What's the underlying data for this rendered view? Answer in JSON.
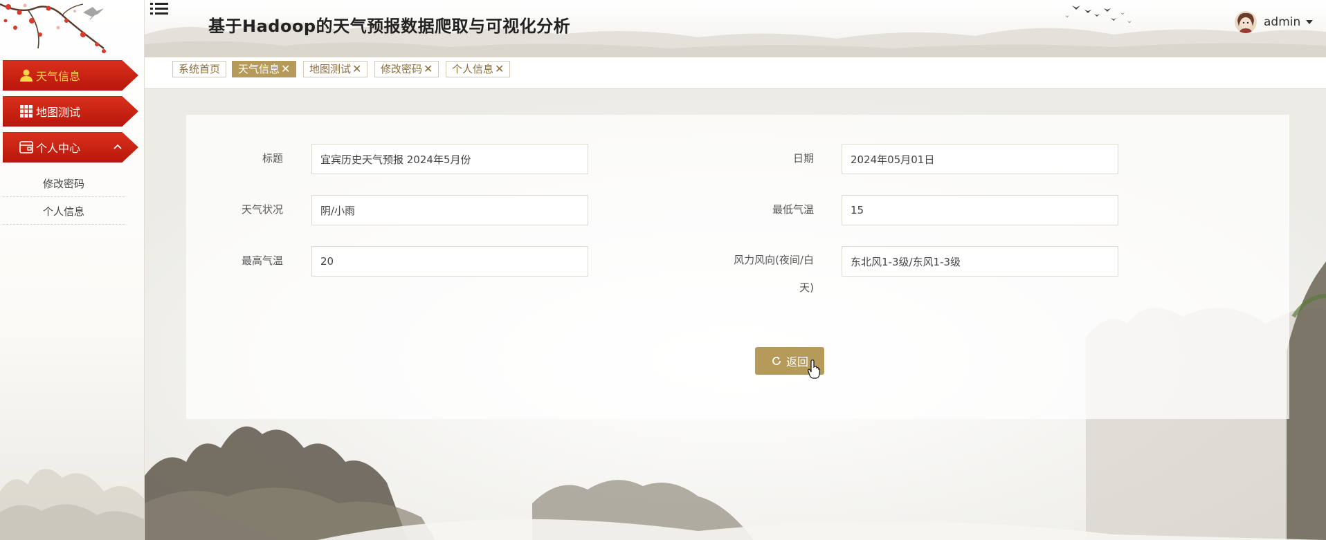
{
  "header": {
    "title": "基于Hadoop的天气预报数据爬取与可视化分析",
    "user_name": "admin"
  },
  "sidebar": {
    "items": [
      {
        "label": "天气信息",
        "icon": "user-icon",
        "active": true
      },
      {
        "label": "地图测试",
        "icon": "grid-icon",
        "active": false
      },
      {
        "label": "个人中心",
        "icon": "wallet-icon",
        "active": false,
        "expanded": true
      }
    ],
    "sub_items": [
      {
        "label": "修改密码"
      },
      {
        "label": "个人信息"
      }
    ]
  },
  "tabs": [
    {
      "label": "系统首页",
      "closable": false,
      "active": false
    },
    {
      "label": "天气信息",
      "closable": true,
      "active": true
    },
    {
      "label": "地图测试",
      "closable": true,
      "active": false
    },
    {
      "label": "修改密码",
      "closable": true,
      "active": false
    },
    {
      "label": "个人信息",
      "closable": true,
      "active": false
    }
  ],
  "tab_close_glyph": "✕",
  "form": {
    "title_label": "标题",
    "title_value": "宜宾历史天气预报 2024年5月份",
    "date_label": "日期",
    "date_value": "2024年05月01日",
    "weather_label": "天气状况",
    "weather_value": "阴/小雨",
    "low_temp_label": "最低气温",
    "low_temp_value": "15",
    "high_temp_label": "最高气温",
    "high_temp_value": "20",
    "wind_label_line1": "风力风向(夜间/白",
    "wind_label_line2": "天)",
    "wind_value": "东北风1-3级/东风1-3级"
  },
  "buttons": {
    "back_label": "返回"
  },
  "colors": {
    "menu_red": "#c8220f",
    "active_text": "#ffd54a",
    "accent_gold": "#b59a5a",
    "tab_text": "#8a6d3b"
  }
}
